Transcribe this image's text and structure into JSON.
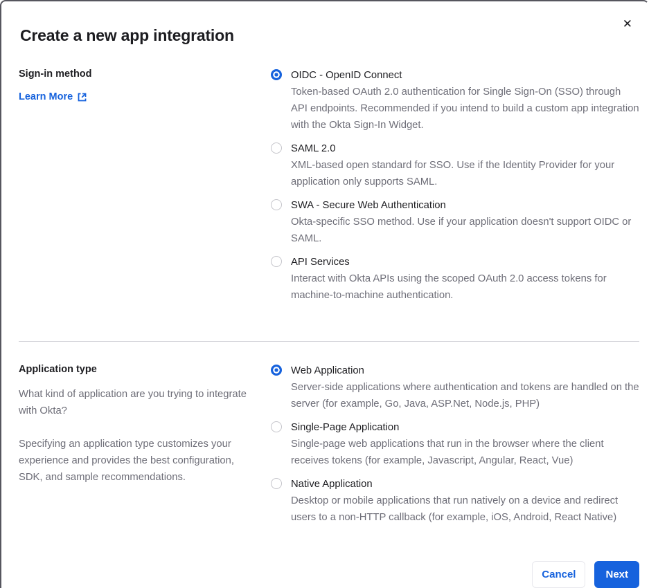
{
  "modal": {
    "title": "Create a new app integration",
    "close_icon": "✕"
  },
  "signin_section": {
    "label": "Sign-in method",
    "learn_more_label": "Learn More",
    "options": [
      {
        "label": "OIDC - OpenID Connect",
        "description": "Token-based OAuth 2.0 authentication for Single Sign-On (SSO) through API endpoints. Recommended if you intend to build a custom app integration with the Okta Sign-In Widget.",
        "selected": true
      },
      {
        "label": "SAML 2.0",
        "description": "XML-based open standard for SSO. Use if the Identity Provider for your application only supports SAML.",
        "selected": false
      },
      {
        "label": "SWA - Secure Web Authentication",
        "description": "Okta-specific SSO method. Use if your application doesn't support OIDC or SAML.",
        "selected": false
      },
      {
        "label": "API Services",
        "description": "Interact with Okta APIs using the scoped OAuth 2.0 access tokens for machine-to-machine authentication.",
        "selected": false
      }
    ]
  },
  "apptype_section": {
    "label": "Application type",
    "paragraph1": "What kind of application are you trying to integrate with Okta?",
    "paragraph2": "Specifying an application type customizes your experience and provides the best configuration, SDK, and sample recommendations.",
    "options": [
      {
        "label": "Web Application",
        "description": "Server-side applications where authentication and tokens are handled on the server (for example, Go, Java, ASP.Net, Node.js, PHP)",
        "selected": true
      },
      {
        "label": "Single-Page Application",
        "description": "Single-page web applications that run in the browser where the client receives tokens (for example, Javascript, Angular, React, Vue)",
        "selected": false
      },
      {
        "label": "Native Application",
        "description": "Desktop or mobile applications that run natively on a device and redirect users to a non-HTTP callback (for example, iOS, Android, React Native)",
        "selected": false
      }
    ]
  },
  "footer": {
    "cancel_label": "Cancel",
    "next_label": "Next"
  },
  "colors": {
    "primary_blue": "#1662dd",
    "heading_text": "#1d1d21",
    "secondary_text": "#6e6e78",
    "divider": "#d2d2d7"
  }
}
